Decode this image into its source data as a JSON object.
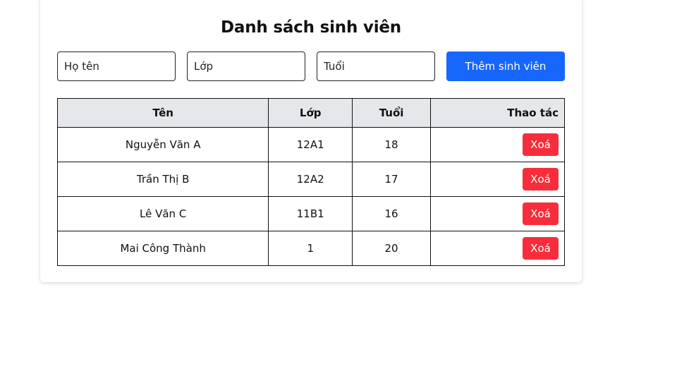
{
  "page": {
    "title": "Danh sách sinh viên"
  },
  "form": {
    "name_placeholder": "Họ tên",
    "class_placeholder": "Lớp",
    "age_placeholder": "Tuổi",
    "add_label": "Thêm sinh viên"
  },
  "table": {
    "headers": [
      "Tên",
      "Lớp",
      "Tuổi",
      "Thao tác"
    ],
    "rows": [
      {
        "name": "Nguyễn Văn A",
        "class": "12A1",
        "age": "18",
        "action": "Xoá"
      },
      {
        "name": "Trần Thị B",
        "class": "12A2",
        "age": "17",
        "action": "Xoá"
      },
      {
        "name": "Lê Văn C",
        "class": "11B1",
        "age": "16",
        "action": "Xoá"
      },
      {
        "name": "Mai Công Thành",
        "class": "1",
        "age": "20",
        "action": "Xoá"
      }
    ]
  },
  "colors": {
    "primary": "#1766fb",
    "danger": "#f82d3c",
    "header_bg": "#e6e7eb"
  }
}
